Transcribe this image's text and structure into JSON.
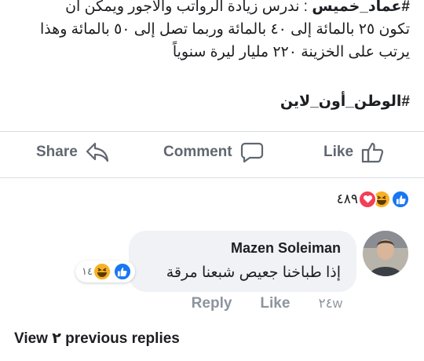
{
  "post": {
    "hashtag_author": "#عماد_خميس",
    "body_line1_rest": " : ندرس زيادة الرواتب والأجور ويمكن أن",
    "body_line2": "تكون ٢٥ بالمائة إلى ٤٠ بالمائة وربما تصل إلى ٥٠ بالمائة وهذا",
    "body_line3": "يرتب على الخزينة ٢٢٠ مليار ليرة سنوياً",
    "hashtag": "#الوطن_أون_لاين"
  },
  "actions": {
    "like": "Like",
    "comment": "Comment",
    "share": "Share"
  },
  "reactions": {
    "icons": [
      "like-icon",
      "haha-icon",
      "love-icon"
    ],
    "count": "٤٨٩"
  },
  "comment": {
    "author": "Mazen Soleiman",
    "text": "إذا طباخنا جعيص شبعنا مرقة",
    "reaction_icons": [
      "like-icon",
      "haha-icon"
    ],
    "reaction_count": "١٤",
    "time": "٢٤w",
    "like_label": "Like",
    "reply_label": "Reply"
  },
  "view_previous": "View ٢ previous replies",
  "colors": {
    "like_blue": "#1877f2",
    "haha_yellow": "#f7b125",
    "love_red": "#f33e58",
    "muted_text": "#606770",
    "bubble_bg": "#f0f2f5"
  }
}
